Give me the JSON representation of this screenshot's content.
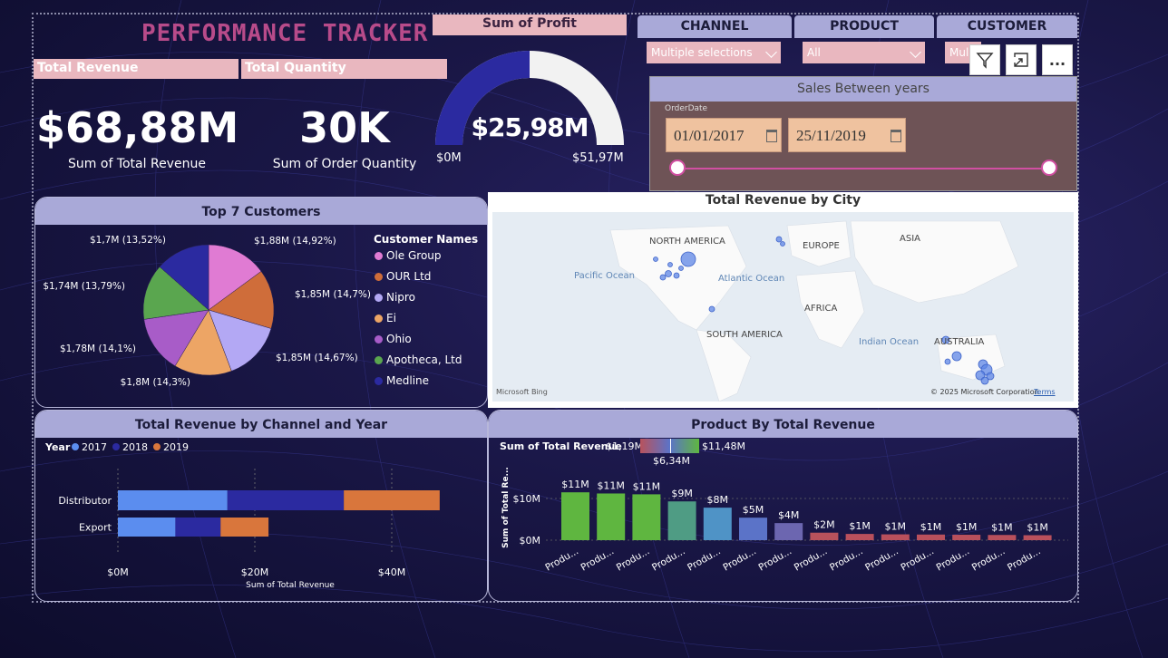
{
  "app": {
    "title": "PERFORMANCE TRACKER"
  },
  "kpis": {
    "revenue_header": "Total Revenue",
    "quantity_header": "Total Quantity",
    "revenue_value": "$68,88M",
    "revenue_label": "Sum of Total Revenue",
    "quantity_value": "30K",
    "quantity_label": "Sum of Order Quantity"
  },
  "profit": {
    "title": "Sum of Profit",
    "value": "$25,98M",
    "min": "$0M",
    "max": "$51,97M",
    "fill_fraction": 0.5
  },
  "slicers": {
    "channel": {
      "label": "CHANNEL",
      "value": "Multiple selections"
    },
    "product": {
      "label": "PRODUCT",
      "value": "All"
    },
    "customer": {
      "label": "CUSTOMER",
      "value": "Mul"
    }
  },
  "toolbar": {
    "filter_icon": "filter-icon",
    "focus_icon": "focus-mode-icon",
    "more_label": "..."
  },
  "sales_between": {
    "title": "Sales Between years",
    "field": "OrderDate",
    "start": "01/01/2017",
    "end": "25/11/2019"
  },
  "customers_card": {
    "title": "Top 7 Customers",
    "legend_title": "Customer Names"
  },
  "map_card": {
    "title": "Total Revenue by City",
    "labels": {
      "north_america": "NORTH AMERICA",
      "europe": "EUROPE",
      "asia": "ASIA",
      "pacific": "Pacific Ocean",
      "atlantic": "Atlantic Ocean",
      "africa": "AFRICA",
      "south_america": "SOUTH AMERICA",
      "indian": "Indian Ocean",
      "australia": "AUSTRALIA"
    },
    "bing": "Microsoft Bing",
    "copyright": "© 2025 Microsoft Corporation",
    "terms": "Terms"
  },
  "channel_card": {
    "title": "Total Revenue by Channel and Year"
  },
  "product_card": {
    "title": "Product By Total Revenue",
    "gradient_label": "Sum of Total Revenue",
    "gradient_min": "$1,19M",
    "gradient_max": "$11,48M",
    "gradient_mid": "$6,34M"
  },
  "colors": {
    "accent_pink": "#e9b7bf",
    "header_lavender": "#a9a9d8",
    "gauge_fill": "#2b2aa0",
    "year_2017": "#5b8def",
    "year_2018": "#2b2aa0",
    "year_2019": "#d9763c"
  },
  "chart_data": [
    {
      "type": "pie",
      "title": "Top 7 Customers",
      "legend_title": "Customer Names",
      "slices": [
        {
          "name": "Ole Group",
          "value": 1.88,
          "label": "$1,88M (14,92%)",
          "color": "#e07bd3"
        },
        {
          "name": "OUR Ltd",
          "value": 1.85,
          "label": "$1,85M (14,7%)",
          "color": "#cf6d3a"
        },
        {
          "name": "Nipro",
          "value": 1.85,
          "label": "$1,85M (14,67%)",
          "color": "#b3a8f4"
        },
        {
          "name": "Ei",
          "value": 1.8,
          "label": "$1,8M (14,3%)",
          "color": "#eda565"
        },
        {
          "name": "Ohio",
          "value": 1.78,
          "label": "$1,78M (14,1%)",
          "color": "#a85cc8"
        },
        {
          "name": "Apotheca, Ltd",
          "value": 1.74,
          "label": "$1,74M (13,79%)",
          "color": "#5aa64f"
        },
        {
          "name": "Medline",
          "value": 1.7,
          "label": "$1,7M (13,52%)",
          "color": "#2b2aa0"
        }
      ]
    },
    {
      "type": "bar",
      "orientation": "horizontal",
      "stacked": true,
      "title": "Total Revenue by Channel and Year",
      "categories": [
        "Distributor",
        "Export"
      ],
      "legend_title": "Year",
      "series": [
        {
          "name": "2017",
          "values": [
            16,
            8.4
          ],
          "color": "#5b8def"
        },
        {
          "name": "2018",
          "values": [
            17,
            6.6
          ],
          "color": "#2b2aa0"
        },
        {
          "name": "2019",
          "values": [
            14,
            7
          ],
          "color": "#d9763c"
        }
      ],
      "xlabel": "Sum of Total Revenue",
      "xticks": [
        "$0M",
        "$20M",
        "$40M"
      ],
      "xlim": [
        0,
        48
      ]
    },
    {
      "type": "bar",
      "title": "Product By Total Revenue",
      "categories": [
        "Produ...",
        "Produ...",
        "Produ...",
        "Produ...",
        "Produ...",
        "Produ...",
        "Produ...",
        "Produ...",
        "Produ...",
        "Produ...",
        "Produ...",
        "Produ...",
        "Produ...",
        "Produ..."
      ],
      "values": [
        11.48,
        11.2,
        11.0,
        9.3,
        7.8,
        5.4,
        4.1,
        1.8,
        1.5,
        1.4,
        1.35,
        1.3,
        1.25,
        1.19
      ],
      "data_labels": [
        "$11M",
        "$11M",
        "$11M",
        "$9M",
        "$8M",
        "$5M",
        "$4M",
        "$2M",
        "$1M",
        "$1M",
        "$1M",
        "$1M",
        "$1M",
        "$1M"
      ],
      "colors": [
        "#5fb640",
        "#5fb640",
        "#5fb640",
        "#4f9c84",
        "#4f93c6",
        "#5b73c8",
        "#6c66b0",
        "#b8525c",
        "#b9505c",
        "#b9505c",
        "#b9505c",
        "#b9505c",
        "#b9505c",
        "#b9505c"
      ],
      "ylabel": "Sum of Total Re...",
      "yticks": [
        "$0M",
        "$10M"
      ],
      "ylim": [
        0,
        13
      ]
    }
  ]
}
